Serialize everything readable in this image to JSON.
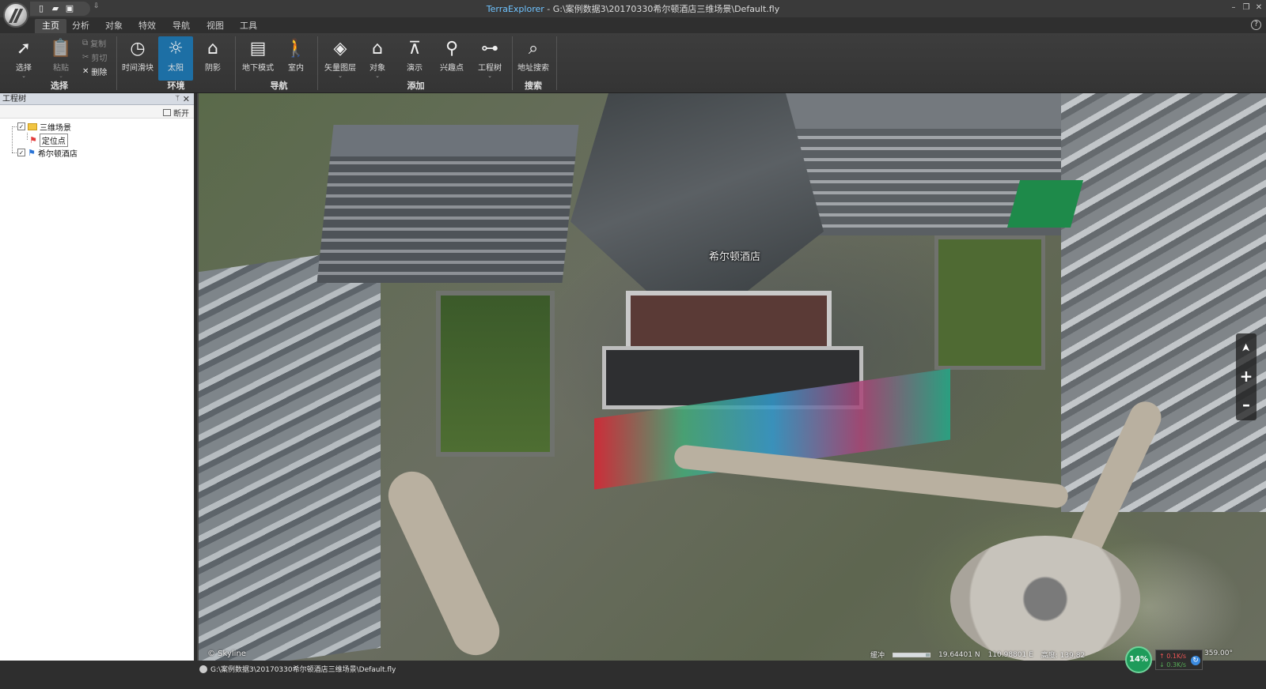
{
  "titlebar": {
    "app_name": "TerraExplorer",
    "separator": " - ",
    "file_path": "G:\\案例数据3\\20170330希尔顿酒店三维场景\\Default.fly",
    "qat_more": "⇩",
    "controls": {
      "minimize": "–",
      "restore": "❐",
      "close": "✕"
    }
  },
  "menu": {
    "tabs": [
      "主页",
      "分析",
      "对象",
      "特效",
      "导航",
      "视图",
      "工具"
    ],
    "help": "?"
  },
  "ribbon": {
    "select": {
      "label": "选择"
    },
    "paste": {
      "label": "粘贴"
    },
    "copy": {
      "label": "复制"
    },
    "cut": {
      "label": "剪切"
    },
    "delete": {
      "label": "删除"
    },
    "time_slider": {
      "label": "时间滑块"
    },
    "sun": {
      "label": "太阳"
    },
    "shadow": {
      "label": "阴影"
    },
    "underground": {
      "label": "地下模式"
    },
    "indoor": {
      "label": "室内"
    },
    "vector_layer": {
      "label": "矢量图层"
    },
    "object": {
      "label": "对象"
    },
    "presentation": {
      "label": "演示"
    },
    "poi": {
      "label": "兴趣点"
    },
    "project_tree": {
      "label": "工程树"
    },
    "address_search": {
      "label": "地址搜索"
    },
    "groups": {
      "select": "选择",
      "environment": "环境",
      "navigation": "导航",
      "add": "添加",
      "search": "搜索"
    }
  },
  "panel": {
    "title": "工程树",
    "pin": "ᛘ",
    "close": "✕",
    "disconnect": "断开",
    "tree": [
      {
        "label": "三维场景",
        "checked": true
      },
      {
        "label": "定位点"
      },
      {
        "label": "希尔顿酒店",
        "checked": true
      }
    ],
    "check_mark": "✓"
  },
  "viewport": {
    "building_label": "希尔顿酒店",
    "credit": "© Skyline",
    "nav": {
      "compass": "➤",
      "zoom_in": "+",
      "zoom_out": "–"
    },
    "buffer_label": "缓冲",
    "buffer_level": 0.9,
    "lat": "19.64401 N",
    "lon": "110.98801 E",
    "altitude": "高度: 139.82",
    "progress": "14%",
    "progress_value": 14,
    "net_up": "↑  0.1K/s",
    "net_down": "↓  0.3K/s",
    "heading": "359.00°"
  },
  "status": {
    "path": "G:\\案例数据3\\20170330希尔顿酒店三维场景\\Default.fly"
  }
}
